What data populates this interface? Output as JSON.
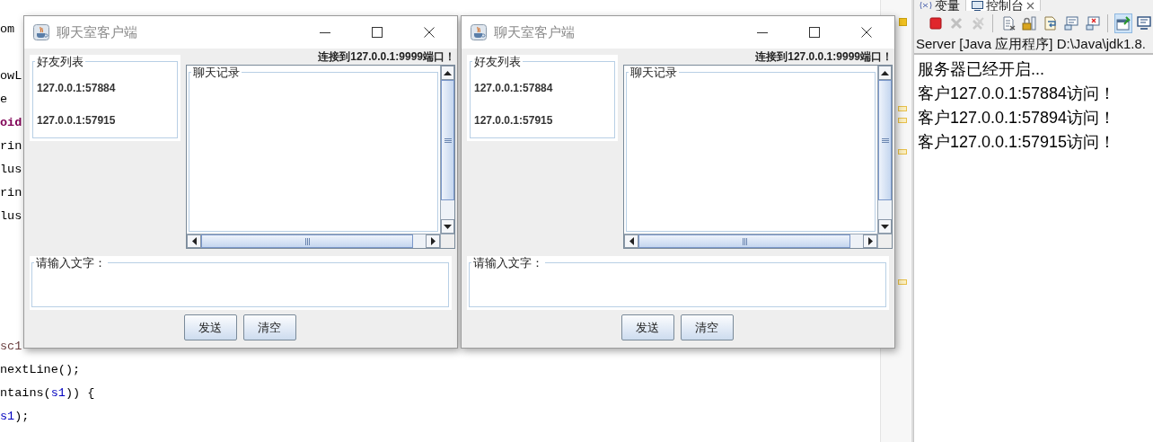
{
  "editor": {
    "code_top": [
      [
        {
          "text": "om",
          "kind": "plain"
        }
      ],
      [
        {
          "text": "owL",
          "kind": "plain"
        }
      ],
      [
        {
          "text": "e",
          "kind": "plain"
        }
      ],
      [
        {
          "text": "oid",
          "kind": "keyword"
        }
      ],
      [
        {
          "text": "rin",
          "kind": "plain"
        }
      ],
      [
        {
          "text": "lus",
          "kind": "plain"
        }
      ],
      [
        {
          "text": "rin",
          "kind": "plain"
        }
      ],
      [
        {
          "text": "lus",
          "kind": "plain"
        }
      ]
    ],
    "code_bottom": [
      [
        {
          "text": "sc1",
          "kind": "local"
        }
      ],
      [
        {
          "text": "nextLine();",
          "kind": "plain"
        }
      ],
      [
        {
          "text": "ntains(",
          "kind": "plain"
        },
        {
          "text": "s1",
          "kind": "field"
        },
        {
          "text": ")) {",
          "kind": "plain"
        }
      ],
      [
        {
          "text": "s1",
          "kind": "field"
        },
        {
          "text": ");",
          "kind": "plain"
        }
      ]
    ]
  },
  "windows": [
    {
      "title": "聊天室客户端",
      "friends_title": "好友列表",
      "friends": [
        "127.0.0.1:57884",
        "127.0.0.1:57915"
      ],
      "status": "连接到127.0.0.1:9999端口！",
      "chat_title": "聊天记录",
      "input_title": "请输入文字：",
      "buttons": [
        "发送",
        "清空"
      ]
    },
    {
      "title": "聊天室客户端",
      "friends_title": "好友列表",
      "friends": [
        "127.0.0.1:57884",
        "127.0.0.1:57915"
      ],
      "status": "连接到127.0.0.1:9999端口！",
      "chat_title": "聊天记录",
      "input_title": "请输入文字：",
      "buttons": [
        "发送",
        "清空"
      ]
    }
  ],
  "console": {
    "tabs": [
      {
        "label": "变量",
        "selected": false
      },
      {
        "label": "控制台",
        "selected": true
      }
    ],
    "tools": [
      {
        "kind": "stop",
        "disabled": false,
        "pressed": false
      },
      {
        "kind": "remove",
        "disabled": true,
        "pressed": false
      },
      {
        "kind": "remove-all",
        "disabled": true,
        "pressed": false
      },
      {
        "kind": "separator"
      },
      {
        "kind": "clear",
        "disabled": false,
        "pressed": false
      },
      {
        "kind": "scroll-lock",
        "disabled": false,
        "pressed": false
      },
      {
        "kind": "word-wrap",
        "disabled": false,
        "pressed": false
      },
      {
        "kind": "show-out",
        "disabled": false,
        "pressed": false
      },
      {
        "kind": "show-err",
        "disabled": false,
        "pressed": false
      },
      {
        "kind": "separator"
      },
      {
        "kind": "pin",
        "disabled": false,
        "pressed": true
      },
      {
        "kind": "display",
        "disabled": false,
        "pressed": false
      }
    ],
    "process": "Server [Java 应用程序] D:\\Java\\jdk1.8.",
    "lines": [
      "服务器已经开启...",
      "客户127.0.0.1:57884访问！",
      "客户127.0.0.1:57894访问！",
      "客户127.0.0.1:57915访问！"
    ]
  }
}
